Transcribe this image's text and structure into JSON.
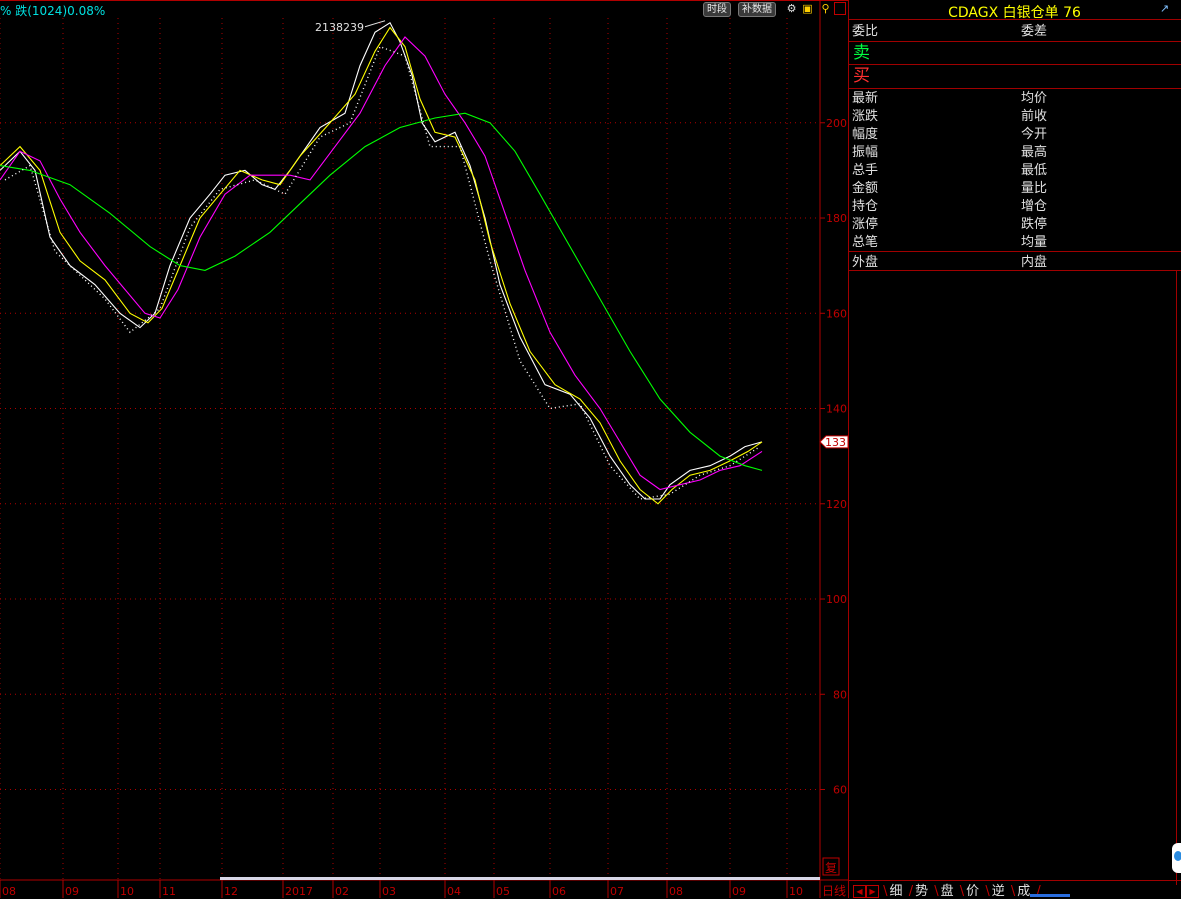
{
  "status": {
    "text": "% 跌(1024)0.08%"
  },
  "toolbar": {
    "period_label": "时段",
    "supplement_label": "补数据"
  },
  "panel": {
    "title": "CDAGX  白银仓单  76",
    "sell_label": "卖",
    "buy_label": "买",
    "fields": [
      [
        "委比",
        "委差"
      ],
      [
        "最新",
        "均价"
      ],
      [
        "涨跌",
        "前收"
      ],
      [
        "幅度",
        "今开"
      ],
      [
        "振幅",
        "最高"
      ],
      [
        "总手",
        "最低"
      ],
      [
        "金额",
        "量比"
      ],
      [
        "持仓",
        "增仓"
      ],
      [
        "涨停",
        "跌停"
      ],
      [
        "总笔",
        "均量"
      ],
      [
        "外盘",
        "内盘"
      ]
    ],
    "tabs": [
      "细",
      "势",
      "盘",
      "价",
      "逆",
      "成"
    ]
  },
  "chart_data": {
    "type": "line",
    "period_label": "日线",
    "restore_label": "复",
    "max_label": "2138239",
    "current_value_label": "133",
    "y_axis": {
      "ticks": [
        60,
        80,
        100,
        120,
        140,
        160,
        180,
        200
      ],
      "range": [
        41,
        222
      ]
    },
    "x_axis": {
      "labels": [
        {
          "t": 0,
          "label": "08"
        },
        {
          "t": 63,
          "label": "09"
        },
        {
          "t": 118,
          "label": "10"
        },
        {
          "t": 160,
          "label": "11"
        },
        {
          "t": 222,
          "label": "12"
        },
        {
          "t": 283,
          "label": "2017"
        },
        {
          "t": 333,
          "label": "02"
        },
        {
          "t": 380,
          "label": "03"
        },
        {
          "t": 445,
          "label": "04"
        },
        {
          "t": 494,
          "label": "05"
        },
        {
          "t": 550,
          "label": "06"
        },
        {
          "t": 608,
          "label": "07"
        },
        {
          "t": 667,
          "label": "08"
        },
        {
          "t": 730,
          "label": "09"
        },
        {
          "t": 787,
          "label": "10"
        }
      ],
      "range": [
        0,
        820
      ]
    },
    "colors": {
      "background": "#000000",
      "grid": "#b00000",
      "axis_text": "#c00000",
      "price": "#ffffff",
      "ma_short": "#ffff00",
      "ma_mid": "#ff00ff",
      "ma_long": "#00ff00"
    },
    "series": [
      {
        "color": "#ffffff",
        "points": [
          [
            0,
            190
          ],
          [
            20,
            194
          ],
          [
            35,
            190
          ],
          [
            50,
            176
          ],
          [
            70,
            170
          ],
          [
            95,
            166
          ],
          [
            120,
            160
          ],
          [
            140,
            157
          ],
          [
            155,
            160
          ],
          [
            170,
            170
          ],
          [
            190,
            180
          ],
          [
            210,
            185
          ],
          [
            225,
            189
          ],
          [
            245,
            190
          ],
          [
            262,
            187
          ],
          [
            275,
            186
          ],
          [
            290,
            190
          ],
          [
            320,
            199
          ],
          [
            345,
            202
          ],
          [
            360,
            212
          ],
          [
            375,
            219
          ],
          [
            390,
            221
          ],
          [
            400,
            217
          ],
          [
            412,
            210
          ],
          [
            422,
            200
          ],
          [
            435,
            196
          ],
          [
            455,
            198
          ],
          [
            470,
            191
          ],
          [
            485,
            180
          ],
          [
            500,
            166
          ],
          [
            520,
            155
          ],
          [
            545,
            145
          ],
          [
            570,
            143
          ],
          [
            590,
            138
          ],
          [
            610,
            130
          ],
          [
            630,
            124
          ],
          [
            645,
            121
          ],
          [
            660,
            121
          ],
          [
            670,
            124
          ],
          [
            690,
            127
          ],
          [
            710,
            128
          ],
          [
            730,
            130
          ],
          [
            745,
            132
          ],
          [
            762,
            133
          ]
        ]
      },
      {
        "color": "#ffff00",
        "points": [
          [
            0,
            191
          ],
          [
            20,
            195
          ],
          [
            40,
            190
          ],
          [
            60,
            177
          ],
          [
            80,
            171
          ],
          [
            105,
            167
          ],
          [
            130,
            160
          ],
          [
            148,
            158
          ],
          [
            162,
            161
          ],
          [
            180,
            170
          ],
          [
            200,
            180
          ],
          [
            220,
            185
          ],
          [
            240,
            190
          ],
          [
            262,
            188
          ],
          [
            280,
            187
          ],
          [
            300,
            193
          ],
          [
            330,
            200
          ],
          [
            355,
            206
          ],
          [
            375,
            215
          ],
          [
            390,
            220
          ],
          [
            405,
            216
          ],
          [
            420,
            205
          ],
          [
            435,
            198
          ],
          [
            455,
            197
          ],
          [
            475,
            188
          ],
          [
            490,
            175
          ],
          [
            510,
            162
          ],
          [
            530,
            152
          ],
          [
            555,
            145
          ],
          [
            580,
            142
          ],
          [
            600,
            137
          ],
          [
            620,
            129
          ],
          [
            640,
            123
          ],
          [
            658,
            120
          ],
          [
            672,
            123
          ],
          [
            690,
            126
          ],
          [
            710,
            127
          ],
          [
            730,
            129
          ],
          [
            748,
            131
          ],
          [
            762,
            133
          ]
        ]
      },
      {
        "color": "#ff00ff",
        "points": [
          [
            0,
            188
          ],
          [
            20,
            194
          ],
          [
            40,
            192
          ],
          [
            60,
            184
          ],
          [
            80,
            177
          ],
          [
            105,
            170
          ],
          [
            125,
            165
          ],
          [
            145,
            160
          ],
          [
            160,
            159
          ],
          [
            178,
            165
          ],
          [
            200,
            176
          ],
          [
            225,
            185
          ],
          [
            250,
            189
          ],
          [
            270,
            189
          ],
          [
            290,
            189
          ],
          [
            310,
            188
          ],
          [
            335,
            195
          ],
          [
            360,
            202
          ],
          [
            385,
            212
          ],
          [
            405,
            218
          ],
          [
            425,
            214
          ],
          [
            445,
            206
          ],
          [
            465,
            200
          ],
          [
            485,
            193
          ],
          [
            505,
            181
          ],
          [
            525,
            169
          ],
          [
            550,
            156
          ],
          [
            575,
            147
          ],
          [
            600,
            140
          ],
          [
            620,
            133
          ],
          [
            640,
            126
          ],
          [
            660,
            123
          ],
          [
            680,
            124
          ],
          [
            700,
            125
          ],
          [
            720,
            127
          ],
          [
            740,
            128
          ],
          [
            762,
            131
          ]
        ]
      },
      {
        "color": "#00ff00",
        "points": [
          [
            0,
            191
          ],
          [
            30,
            190
          ],
          [
            70,
            187
          ],
          [
            110,
            181
          ],
          [
            150,
            174
          ],
          [
            180,
            170
          ],
          [
            205,
            169
          ],
          [
            235,
            172
          ],
          [
            270,
            177
          ],
          [
            300,
            183
          ],
          [
            330,
            189
          ],
          [
            365,
            195
          ],
          [
            400,
            199
          ],
          [
            435,
            201
          ],
          [
            465,
            202
          ],
          [
            490,
            200
          ],
          [
            515,
            194
          ],
          [
            540,
            185
          ],
          [
            570,
            174
          ],
          [
            600,
            163
          ],
          [
            630,
            152
          ],
          [
            660,
            142
          ],
          [
            690,
            135
          ],
          [
            720,
            130
          ],
          [
            745,
            128
          ],
          [
            762,
            127
          ]
        ]
      },
      {
        "color": "#ffffff",
        "dotted": true,
        "points": [
          [
            5,
            188
          ],
          [
            30,
            191
          ],
          [
            55,
            173
          ],
          [
            80,
            168
          ],
          [
            105,
            163
          ],
          [
            130,
            156
          ],
          [
            160,
            161
          ],
          [
            190,
            178
          ],
          [
            220,
            186
          ],
          [
            255,
            188
          ],
          [
            285,
            185
          ],
          [
            320,
            197
          ],
          [
            350,
            200
          ],
          [
            380,
            216
          ],
          [
            405,
            214
          ],
          [
            430,
            195
          ],
          [
            460,
            195
          ],
          [
            490,
            171
          ],
          [
            520,
            150
          ],
          [
            550,
            140
          ],
          [
            580,
            141
          ],
          [
            610,
            128
          ],
          [
            640,
            121
          ],
          [
            670,
            122
          ],
          [
            700,
            126
          ],
          [
            730,
            128
          ],
          [
            760,
            132
          ]
        ]
      }
    ]
  }
}
